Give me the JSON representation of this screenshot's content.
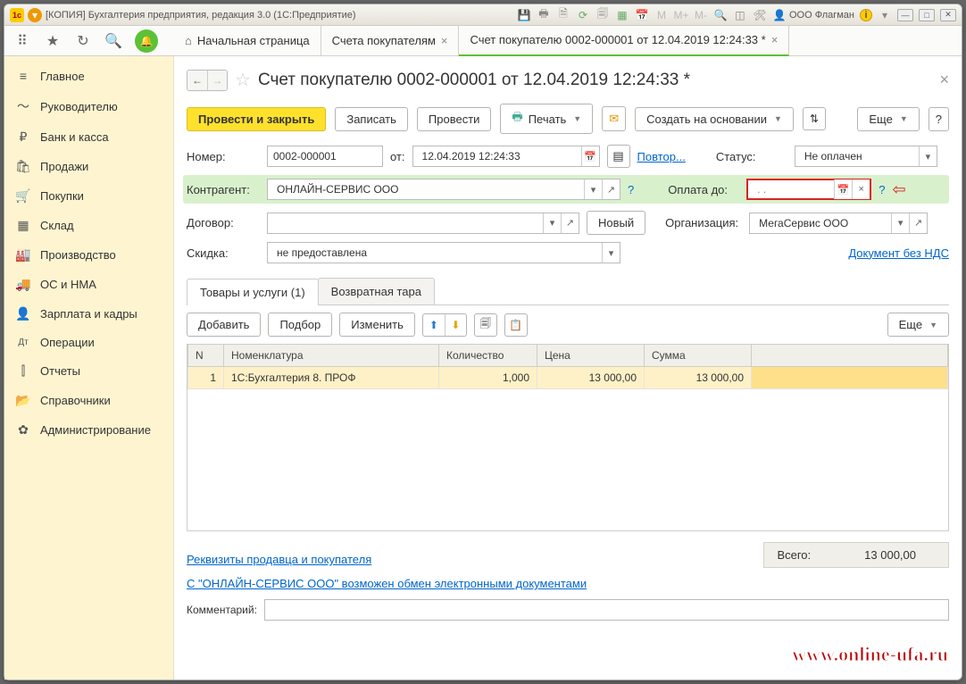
{
  "titlebar": {
    "text": "[КОПИЯ] Бухгалтерия предприятия, редакция 3.0  (1С:Предприятие)",
    "user": "ООО Флагман"
  },
  "tabs": {
    "home": "Начальная страница",
    "t1": "Счета покупателям",
    "t2": "Счет покупателю 0002-000001 от 12.04.2019 12:24:33 *"
  },
  "sidebar": {
    "items": [
      {
        "icon": "≡",
        "label": "Главное"
      },
      {
        "icon": "〜",
        "label": "Руководителю"
      },
      {
        "icon": "₽",
        "label": "Банк и касса"
      },
      {
        "icon": "🛍",
        "label": "Продажи"
      },
      {
        "icon": "🛒",
        "label": "Покупки"
      },
      {
        "icon": "▦",
        "label": "Склад"
      },
      {
        "icon": "🏭",
        "label": "Производство"
      },
      {
        "icon": "🚚",
        "label": "ОС и НМА"
      },
      {
        "icon": "👤",
        "label": "Зарплата и кадры"
      },
      {
        "icon": "Дт",
        "label": "Операции"
      },
      {
        "icon": "⫿",
        "label": "Отчеты"
      },
      {
        "icon": "📂",
        "label": "Справочники"
      },
      {
        "icon": "✿",
        "label": "Администрирование"
      }
    ]
  },
  "page": {
    "title": "Счет покупателю 0002-000001 от 12.04.2019 12:24:33 *",
    "buttons": {
      "primary": "Провести и закрыть",
      "save": "Записать",
      "post": "Провести",
      "print": "Печать",
      "create_based": "Создать на основании",
      "more": "Еще",
      "help": "?"
    },
    "fields": {
      "number_lbl": "Номер:",
      "number_val": "0002-000001",
      "from_lbl": "от:",
      "date_val": "12.04.2019 12:24:33",
      "repeat": "Повтор...",
      "status_lbl": "Статус:",
      "status_val": "Не оплачен",
      "contragent_lbl": "Контрагент:",
      "contragent_val": "ОНЛАЙН-СЕРВИС ООО",
      "paydue_lbl": "Оплата до:",
      "paydue_val": "  .  .    ",
      "dogovor_lbl": "Договор:",
      "dogovor_val": "",
      "new_btn": "Новый",
      "org_lbl": "Организация:",
      "org_val": "МегаСервис ООО",
      "discount_lbl": "Скидка:",
      "discount_val": "не предоставлена",
      "no_vat_link": "Документ без НДС"
    },
    "subtabs": {
      "goods": "Товары и услуги (1)",
      "tara": "Возвратная тара"
    },
    "tabletools": {
      "add": "Добавить",
      "pick": "Подбор",
      "edit": "Изменить",
      "more": "Еще"
    },
    "columns": {
      "n": "N",
      "nomen": "Номенклатура",
      "qty": "Количество",
      "price": "Цена",
      "sum": "Сумма"
    },
    "rows": [
      {
        "n": "1",
        "nomen": "1С:Бухгалтерия 8. ПРОФ",
        "qty": "1,000",
        "price": "13 000,00",
        "sum": "13 000,00"
      }
    ],
    "footer": {
      "req_link": "Реквизиты продавца и покупателя",
      "edo_link": "С \"ОНЛАЙН-СЕРВИС ООО\" возможен обмен электронными документами",
      "total_lbl": "Всего:",
      "total_val": "13 000,00",
      "comment_lbl": "Комментарий:"
    }
  },
  "watermark": "www.online-ufa.ru"
}
